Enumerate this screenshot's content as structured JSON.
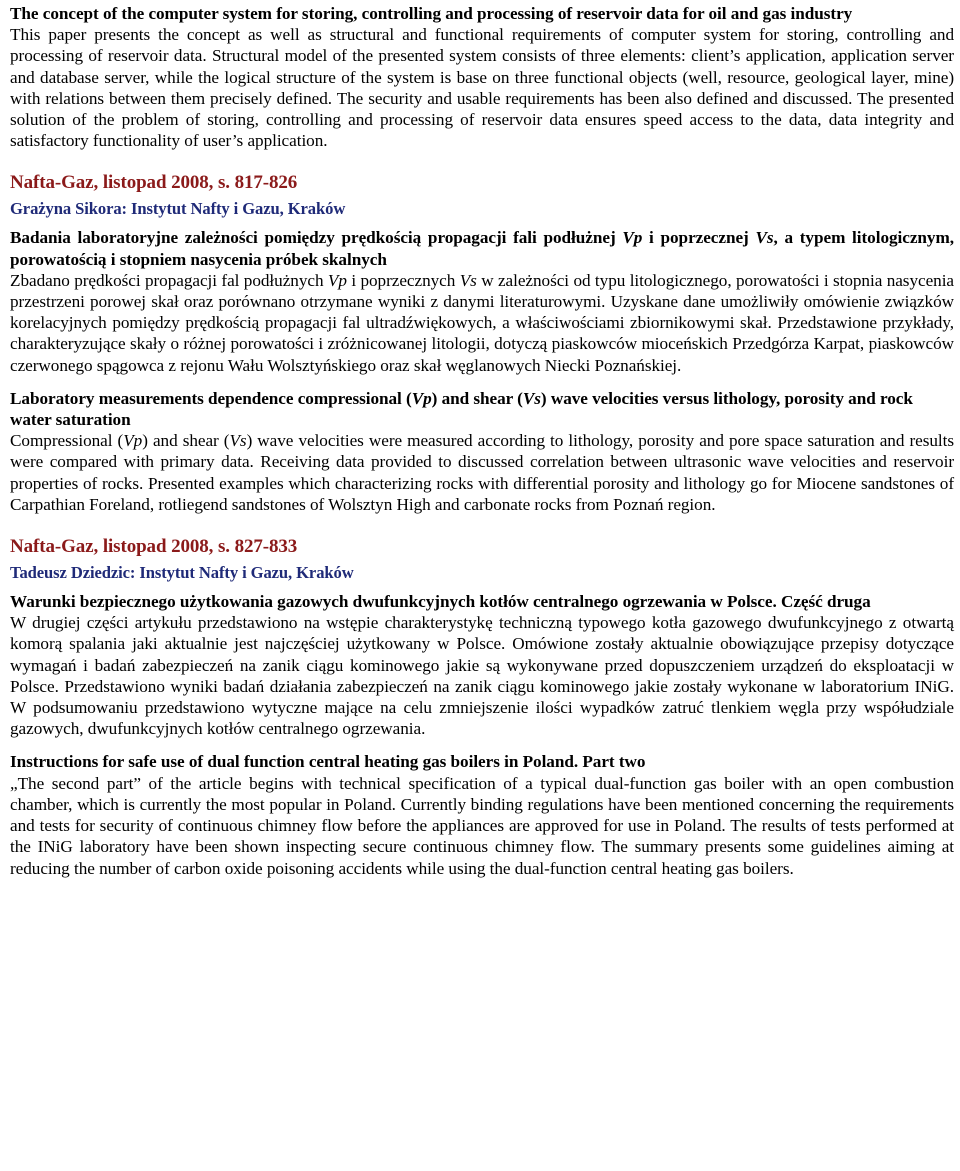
{
  "document": {
    "type": "journal-abstracts-page",
    "language_mix": [
      "en",
      "pl"
    ],
    "colors": {
      "text": "#000000",
      "journal_reference": "#8B1A1A",
      "author": "#1F2A78",
      "background": "#FFFFFF"
    }
  },
  "entries": [
    {
      "id": "entry-0",
      "title_en": "The concept of the computer system for storing, controlling and processing of reservoir data for oil and gas industry",
      "abstract_en": "This paper presents the concept as well as structural and functional requirements of computer system for storing, controlling and processing of reservoir data. Structural model of the presented system consists of three elements: client’s application, application server and database server, while the logical structure of the system is base on three functional objects (well, resource, geological layer, mine) with relations between them precisely defined. The security and usable requirements has been also defined and discussed. The presented solution of the problem of storing, controlling and processing of reservoir data ensures speed access to the data, data integrity and satisfactory functionality of user’s application."
    },
    {
      "id": "entry-1",
      "journal_reference": "Nafta-Gaz, listopad 2008, s. 817-826",
      "author": "Grażyna Sikora: Instytut Nafty i Gazu, Kraków",
      "title_pl_parts": [
        {
          "text": "Badania laboratoryjne zależności pomiędzy prędkością propagacji fali podłużnej ",
          "style": "normal"
        },
        {
          "text": "Vp",
          "style": "italic"
        },
        {
          "text": " i poprzecznej ",
          "style": "normal"
        },
        {
          "text": "Vs",
          "style": "italic"
        },
        {
          "text": ", a typem litologicznym, porowatością i stopniem nasycenia próbek skalnych",
          "style": "normal"
        }
      ],
      "abstract_pl_parts": [
        {
          "text": "Zbadano prędkości propagacji fal podłużnych ",
          "style": "normal"
        },
        {
          "text": "Vp",
          "style": "italic"
        },
        {
          "text": " i poprzecznych ",
          "style": "normal"
        },
        {
          "text": "Vs",
          "style": "italic"
        },
        {
          "text": " w zależności od typu litologicznego, porowatości i stopnia nasycenia przestrzeni porowej skał oraz porównano otrzymane wyniki z danymi literaturowymi. Uzyskane dane umożliwiły omówienie związków korelacyjnych pomiędzy prędkością propagacji fal ultradźwiękowych, a właściwościami zbiornikowymi skał. Przedstawione przykłady, charakteryzujące skały o różnej porowatości i zróżnicowanej litologii, dotyczą piaskowców mioceńskich Przedgórza Karpat, piaskowców czerwonego spągowca z rejonu Wału Wolsztyńskiego oraz skał węglanowych Niecki Poznańskiej.",
          "style": "normal"
        }
      ],
      "title_en_parts": [
        {
          "text": "Laboratory measurements dependence compressional (",
          "style": "normal"
        },
        {
          "text": "Vp",
          "style": "italic"
        },
        {
          "text": ") and shear (",
          "style": "normal"
        },
        {
          "text": "Vs",
          "style": "italic"
        },
        {
          "text": ") wave velocities versus lithology, porosity and rock water saturation",
          "style": "normal"
        }
      ],
      "abstract_en_parts": [
        {
          "text": "Compressional (",
          "style": "normal"
        },
        {
          "text": "Vp",
          "style": "italic"
        },
        {
          "text": ") and shear (",
          "style": "normal"
        },
        {
          "text": "Vs",
          "style": "italic"
        },
        {
          "text": ") wave velocities were measured according to lithology, porosity and pore space saturation and results were compared with primary data. Receiving data provided to discussed correlation between ultrasonic wave velocities and reservoir properties of rocks. Presented examples which characterizing rocks with differential porosity and lithology go for Miocene sandstones of Carpathian Foreland, rotliegend sandstones of Wolsztyn High and carbonate rocks from Poznań region.",
          "style": "normal"
        }
      ]
    },
    {
      "id": "entry-2",
      "journal_reference": "Nafta-Gaz, listopad 2008, s. 827-833",
      "author": "Tadeusz Dziedzic: Instytut Nafty i Gazu, Kraków",
      "title_pl": "Warunki bezpiecznego użytkowania gazowych dwufunkcyjnych kotłów centralnego ogrzewania w Polsce. Część druga",
      "abstract_pl": "W drugiej części artykułu przedstawiono na wstępie charakterystykę techniczną typowego kotła gazowego dwufunkcyjnego z  otwartą komorą spalania jaki aktualnie jest najczęściej użytkowany w Polsce. Omówione zostały aktualnie obowiązujące przepisy dotyczące wymagań i badań zabezpieczeń na zanik ciągu kominowego jakie są wykonywane przed dopuszczeniem urządzeń do eksploatacji w Polsce. Przedstawiono wyniki badań działania zabezpieczeń na zanik ciągu kominowego jakie zostały wykonane w laboratorium INiG.  W podsumowaniu przedstawiono wytyczne mające na celu zmniejszenie ilości wypadków zatruć tlenkiem węgla przy współudziale gazowych, dwufunkcyjnych kotłów centralnego ogrzewania.",
      "title_en": "Instructions for safe use of dual function central heating gas boilers in Poland. Part two",
      "abstract_en": "„The second part” of the article begins with technical specification of a typical dual-function gas boiler with an open combustion chamber, which is currently the most popular in Poland. Currently binding regulations have been mentioned concerning the requirements and tests for security of continuous chimney flow before the appliances are approved for use in Poland. The results of tests performed at the INiG laboratory have been shown inspecting secure continuous chimney flow. The summary presents some guidelines aiming at reducing the number of carbon oxide poisoning accidents while using the dual-function central heating gas boilers."
    }
  ]
}
